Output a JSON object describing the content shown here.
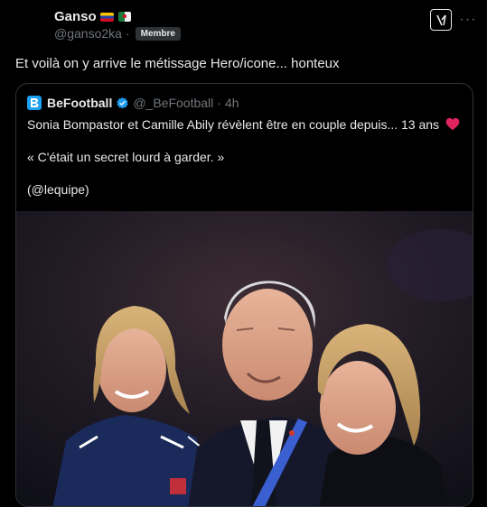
{
  "post": {
    "author_name": "Ganso",
    "handle": "@ganso2ka",
    "separator": "·",
    "badge": "Membre",
    "text": "Et voilà on y arrive le métissage Hero/icone... honteux",
    "grok_icon": "grok-icon",
    "more_icon": "more-icon",
    "more_glyph": "···"
  },
  "quote": {
    "name": "BeFootball",
    "handle": "@_BeFootball",
    "separator": "·",
    "time": "4h",
    "line1": "Sonia Bompastor et Camille Abily révèlent être en couple depuis... 13 ans",
    "line2": "« C'était un secret lourd à garder. »",
    "line3": "(@lequipe)",
    "heart_icon": "heart-icon",
    "verified_icon": "verified-badge-icon"
  },
  "colors": {
    "background": "#000000",
    "text": "#e7e9ea",
    "muted": "#71767b",
    "border": "#2f3336",
    "verified": "#1d9bf0",
    "heart": "#f91880"
  }
}
